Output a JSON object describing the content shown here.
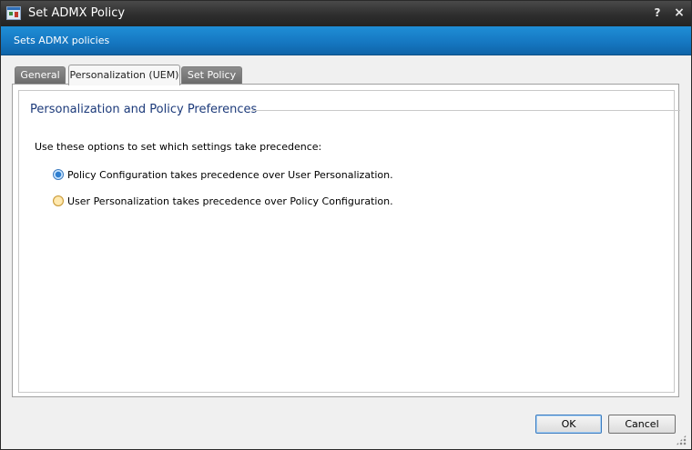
{
  "window": {
    "title": "Set ADMX Policy",
    "help_label": "?",
    "close_label": "×"
  },
  "banner": {
    "text": "Sets ADMX policies"
  },
  "tabs": [
    {
      "label": "General",
      "active": false
    },
    {
      "label": "Personalization (UEM)",
      "active": true
    },
    {
      "label": "Set Policy",
      "active": false
    }
  ],
  "panel": {
    "section_title": "Personalization and Policy Preferences",
    "instructions": "Use these options to set which settings take precedence:",
    "options": [
      {
        "label": "Policy Configuration takes precedence over User Personalization.",
        "checked": true
      },
      {
        "label": "User Personalization takes precedence over Policy Configuration.",
        "checked": false
      }
    ]
  },
  "buttons": {
    "ok": "OK",
    "cancel": "Cancel"
  },
  "colors": {
    "titlebar": "#2e2e2e",
    "banner": "#1576c0",
    "section_title": "#1c3a7a"
  }
}
